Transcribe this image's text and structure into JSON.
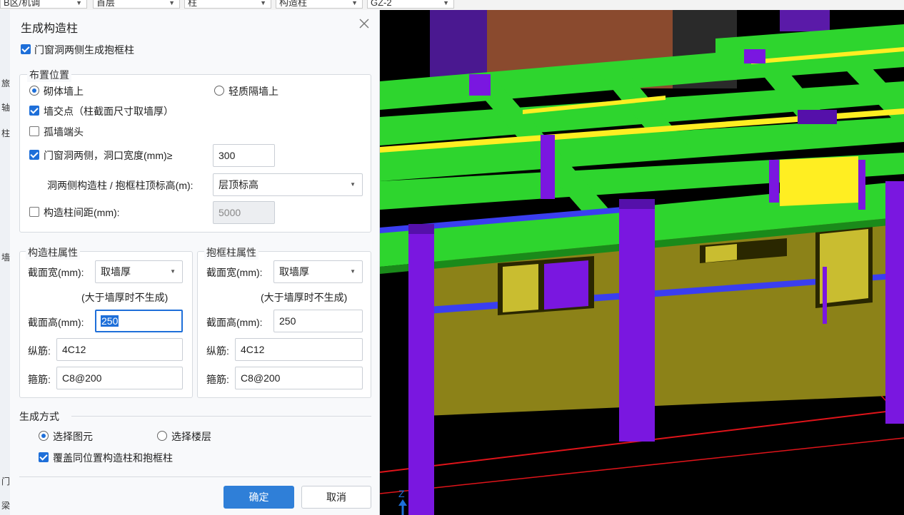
{
  "toolbar": {
    "combos": [
      "B区/机调",
      "首层",
      "柱",
      "构造柱",
      "GZ-2"
    ]
  },
  "left_strip": {
    "letters": [
      "旅",
      "轴",
      "柱",
      "墙",
      "门",
      "梁"
    ]
  },
  "dialog": {
    "title": "生成构造柱",
    "close_icon": "close-icon",
    "top_checkbox": {
      "label": "门窗洞两侧生成抱框柱",
      "checked": true
    },
    "placement": {
      "title": "布置位置",
      "radio_masonry": {
        "label": "砌体墙上",
        "selected": true
      },
      "radio_light": {
        "label": "轻质隔墙上",
        "selected": false
      },
      "wall_intersection": {
        "label": "墙交点（柱截面尺寸取墙厚）",
        "checked": true
      },
      "isolated_end": {
        "label": "孤墙端头",
        "checked": false
      },
      "opening_sides": {
        "label": "门窗洞两侧，洞口宽度(mm)≥",
        "checked": true,
        "value": "300"
      },
      "top_elevation": {
        "label": "洞两侧构造柱 / 抱框柱顶标高(m):",
        "value": "层顶标高"
      },
      "spacing": {
        "label": "构造柱间距(mm):",
        "checked": false,
        "value": "5000"
      }
    },
    "column_props": {
      "title": "构造柱属性",
      "width_label": "截面宽(mm):",
      "width_value": "取墙厚",
      "hint": "(大于墙厚时不生成)",
      "height_label": "截面高(mm):",
      "height_value": "250",
      "long_bar_label": "纵筋:",
      "long_bar_value": "4C12",
      "stirrup_label": "箍筋:",
      "stirrup_value": "C8@200"
    },
    "frame_props": {
      "title": "抱框柱属性",
      "width_label": "截面宽(mm):",
      "width_value": "取墙厚",
      "hint": "(大于墙厚时不生成)",
      "height_label": "截面高(mm):",
      "height_value": "250",
      "long_bar_label": "纵筋:",
      "long_bar_value": "4C12",
      "stirrup_label": "箍筋:",
      "stirrup_value": "C8@200"
    },
    "generation": {
      "title": "生成方式",
      "radio_select_element": {
        "label": "选择图元",
        "selected": true
      },
      "radio_select_floor": {
        "label": "选择楼层",
        "selected": false
      },
      "override": {
        "label": "覆盖同位置构造柱和抱框柱",
        "checked": true
      }
    },
    "buttons": {
      "ok": "确定",
      "cancel": "取消"
    }
  },
  "viewport": {
    "axis_label": "Z",
    "colors": {
      "beam": "#2ed52e",
      "column": "#7a17e0",
      "wall": "#8c8218",
      "stripe": "#ffee22",
      "blue_band": "#3a3ef0",
      "grid_line": "#e0141a"
    }
  }
}
